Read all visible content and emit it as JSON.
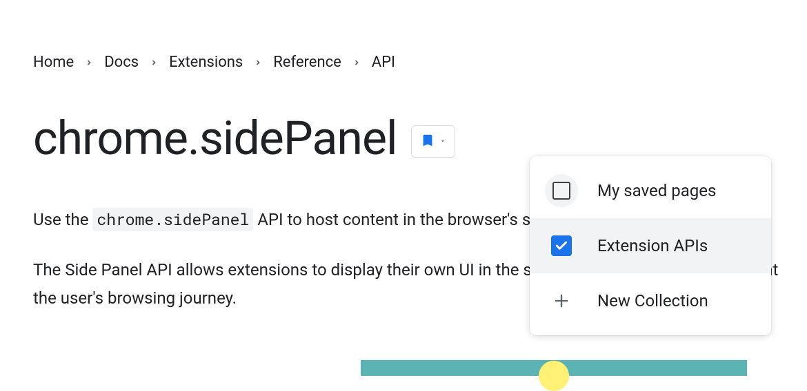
{
  "breadcrumb": {
    "items": [
      "Home",
      "Docs",
      "Extensions",
      "Reference",
      "API"
    ]
  },
  "page": {
    "title": "chrome.sidePanel"
  },
  "body": {
    "para1_pre": "Use the ",
    "para1_code": "chrome.sidePanel",
    "para1_post": " API to host content in the browser's side panel alongside th",
    "para2": "The Side Panel API allows extensions to display their own UI in the side panel, enabling p complement the user's browsing journey."
  },
  "bookmark": {
    "tooltip": "Bookmark"
  },
  "dropdown": {
    "items": [
      {
        "label": "My saved pages",
        "checked": false
      },
      {
        "label": "Extension APIs",
        "checked": true
      },
      {
        "label": "New Collection",
        "action": "new"
      }
    ]
  }
}
